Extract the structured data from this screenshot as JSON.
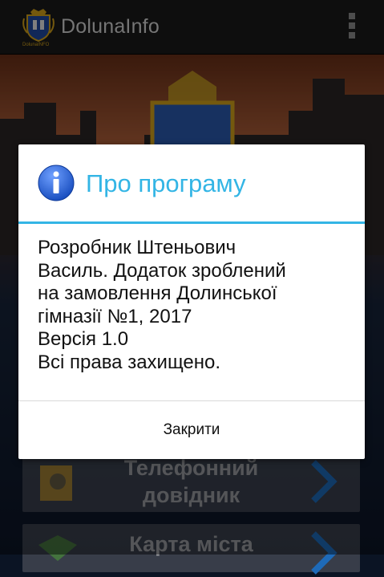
{
  "app": {
    "title": "DolunaInfo",
    "logo_caption": "DolunaINFO"
  },
  "background": {
    "tiles": [
      {
        "label_line1": "Телефонний",
        "label_line2": "довідник"
      },
      {
        "label_line1": "Карта міста",
        "label_line2": ""
      }
    ]
  },
  "dialog": {
    "title": "Про програму",
    "body_lines": [
      "Розробник Штеньович",
      "Василь. Додаток зроблений",
      "на замовлення Долинської",
      "гімназії №1, 2017",
      "Версія 1.0",
      "Всі права захищено."
    ],
    "close_label": "Закрити"
  },
  "colors": {
    "accent": "#33b5e5",
    "actionbar": "#1b1b1b",
    "dialog_bg": "#ffffff"
  },
  "icons": [
    "app-logo-icon",
    "overflow-menu-icon",
    "info-icon",
    "phone-book-icon",
    "map-icon",
    "chevron-right-icon"
  ]
}
